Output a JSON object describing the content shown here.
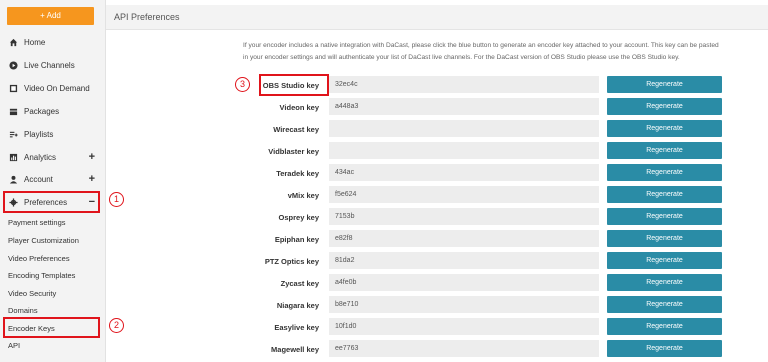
{
  "sidebar": {
    "add_label": "+ Add",
    "items": [
      {
        "label": "Home",
        "icon": "home-icon",
        "expand": ""
      },
      {
        "label": "Live Channels",
        "icon": "live-icon",
        "expand": ""
      },
      {
        "label": "Video On Demand",
        "icon": "video-icon",
        "expand": ""
      },
      {
        "label": "Packages",
        "icon": "packages-icon",
        "expand": ""
      },
      {
        "label": "Playlists",
        "icon": "playlist-icon",
        "expand": ""
      },
      {
        "label": "Analytics",
        "icon": "analytics-icon",
        "expand": "+"
      },
      {
        "label": "Account",
        "icon": "user-icon",
        "expand": "+"
      },
      {
        "label": "Preferences",
        "icon": "gear-icon",
        "expand": "−"
      }
    ],
    "subitems": [
      "Payment settings",
      "Player Customization",
      "Video Preferences",
      "Encoding Templates",
      "Video Security",
      "Domains",
      "Encoder Keys",
      "API"
    ]
  },
  "annotations": [
    "1",
    "2",
    "3"
  ],
  "header": {
    "title": "API Preferences"
  },
  "intro": "If your encoder includes a native integration with DaCast, please click the blue button to generate an encoder key attached to your account. This key can be pasted in your encoder settings and will authenticate your list of DaCast live channels. For the DaCast version of OBS Studio please use the OBS Studio key.",
  "keys": [
    {
      "label": "OBS Studio key",
      "value": "32ec4c",
      "button": "Regenerate"
    },
    {
      "label": "Videon key",
      "value": "a448a3",
      "button": "Regenerate"
    },
    {
      "label": "Wirecast key",
      "value": "",
      "button": "Regenerate"
    },
    {
      "label": "Vidblaster key",
      "value": "",
      "button": "Regenerate"
    },
    {
      "label": "Teradek key",
      "value": "434ac",
      "button": "Regenerate"
    },
    {
      "label": "vMix key",
      "value": "f5e624",
      "button": "Regenerate"
    },
    {
      "label": "Osprey key",
      "value": "7153b",
      "button": "Regenerate"
    },
    {
      "label": "Epiphan key",
      "value": "e82f8",
      "button": "Regenerate"
    },
    {
      "label": "PTZ Optics key",
      "value": "81da2",
      "button": "Regenerate"
    },
    {
      "label": "Zycast key",
      "value": "a4fe0b",
      "button": "Regenerate"
    },
    {
      "label": "Niagara key",
      "value": "b8e710",
      "button": "Regenerate"
    },
    {
      "label": "Easylive key",
      "value": "10f1d0",
      "button": "Regenerate"
    },
    {
      "label": "Magewell key",
      "value": "ee7763",
      "button": "Regenerate"
    }
  ],
  "colors": {
    "accent": "#f6961e",
    "button": "#2a8ca6",
    "highlight": "#e0141b"
  }
}
